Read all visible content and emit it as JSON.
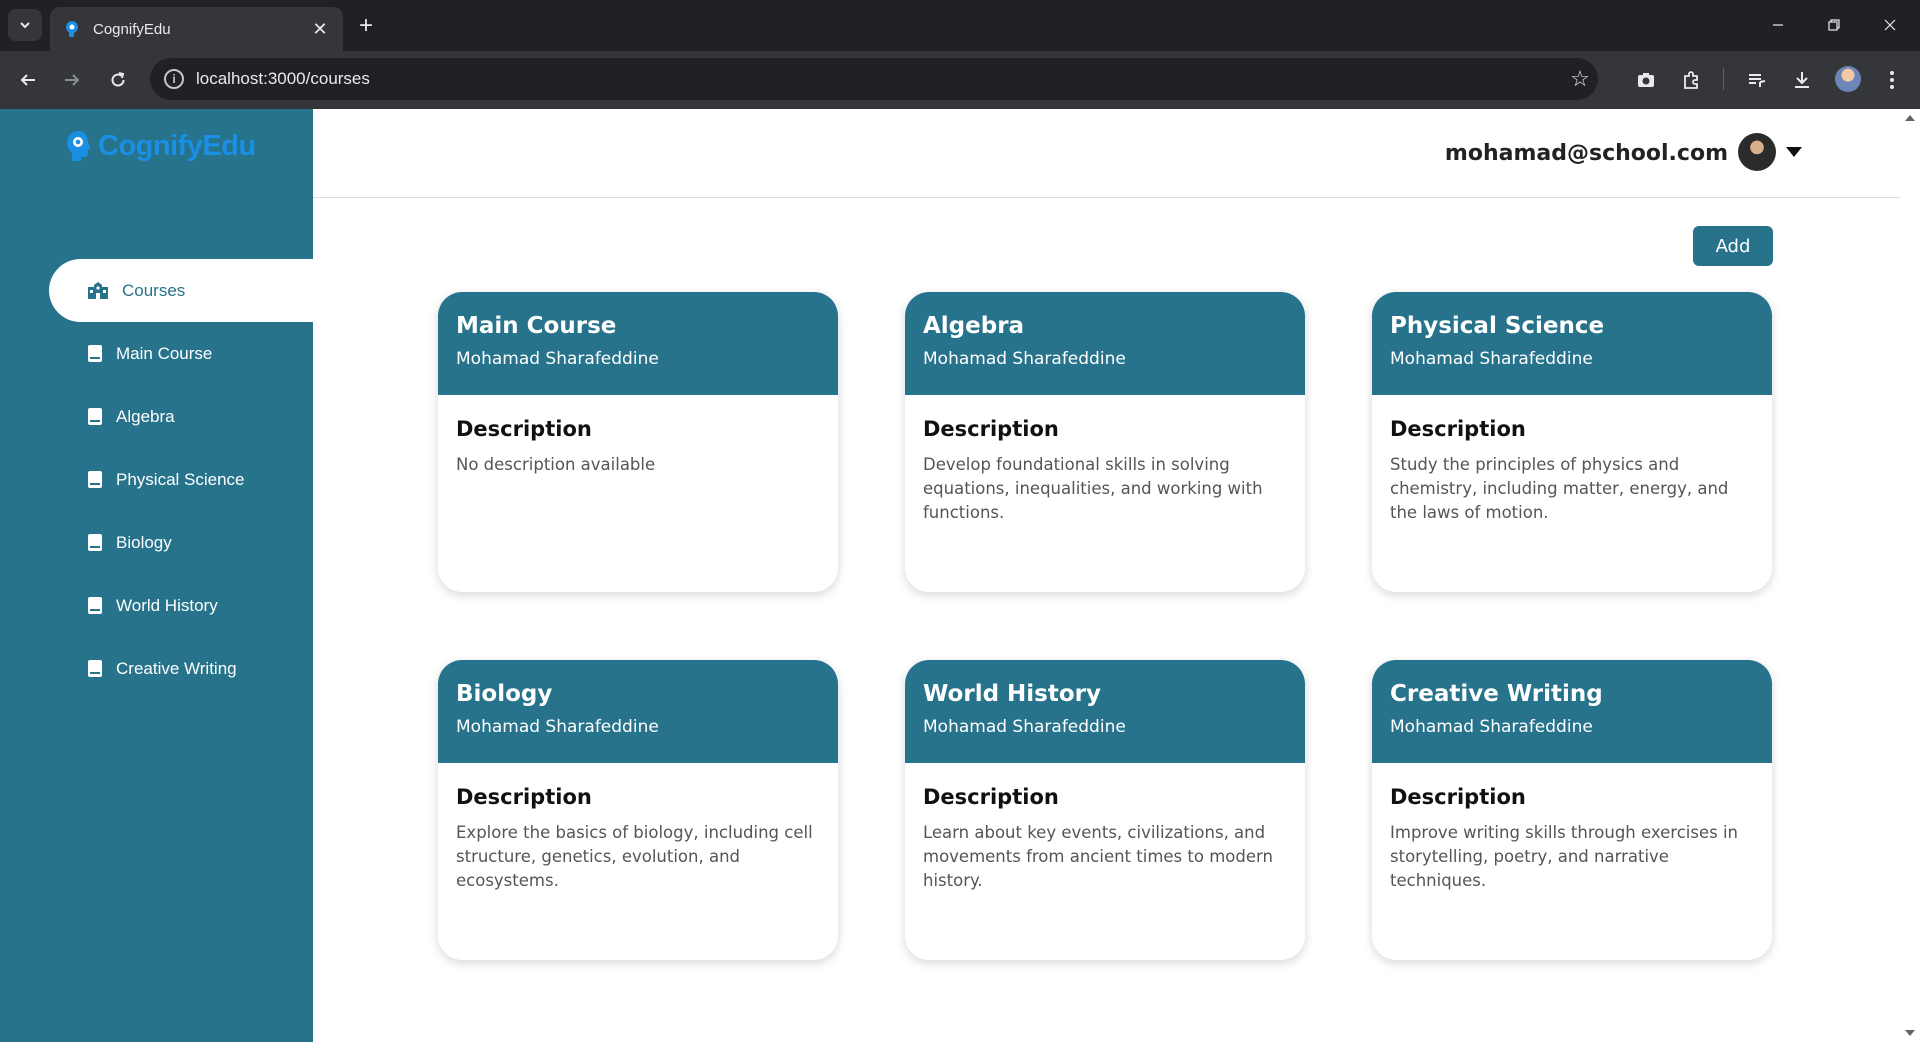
{
  "browser": {
    "tab_title": "CognifyEdu",
    "url": "localhost:3000/courses"
  },
  "app": {
    "logo_prefix": "Cognify",
    "logo_suffix": "Edu"
  },
  "sidebar": {
    "items": [
      {
        "label": "Courses",
        "icon": "school-icon",
        "active": true
      },
      {
        "label": "Main Course",
        "icon": "book-icon"
      },
      {
        "label": "Algebra",
        "icon": "book-icon"
      },
      {
        "label": "Physical Science",
        "icon": "book-icon"
      },
      {
        "label": "Biology",
        "icon": "book-icon"
      },
      {
        "label": "World History",
        "icon": "book-icon"
      },
      {
        "label": "Creative Writing",
        "icon": "book-icon"
      }
    ]
  },
  "header": {
    "user_email": "mohamad@school.com"
  },
  "main": {
    "add_label": "Add",
    "description_heading": "Description",
    "courses": [
      {
        "title": "Main Course",
        "author": "Mohamad Sharafeddine",
        "description": "No description available"
      },
      {
        "title": "Algebra",
        "author": "Mohamad Sharafeddine",
        "description": "Develop foundational skills in solving equations, inequalities, and working with functions."
      },
      {
        "title": "Physical Science",
        "author": "Mohamad Sharafeddine",
        "description": "Study the principles of physics and chemistry, including matter, energy, and the laws of motion."
      },
      {
        "title": "Biology",
        "author": "Mohamad Sharafeddine",
        "description": "Explore the basics of biology, including cell structure, genetics, evolution, and ecosystems."
      },
      {
        "title": "World History",
        "author": "Mohamad Sharafeddine",
        "description": "Learn about key events, civilizations, and movements from ancient times to modern history."
      },
      {
        "title": "Creative Writing",
        "author": "Mohamad Sharafeddine",
        "description": "Improve writing skills through exercises in storytelling, poetry, and narrative techniques."
      }
    ]
  },
  "colors": {
    "primary": "#26738b",
    "logo": "#1a8fe3"
  }
}
